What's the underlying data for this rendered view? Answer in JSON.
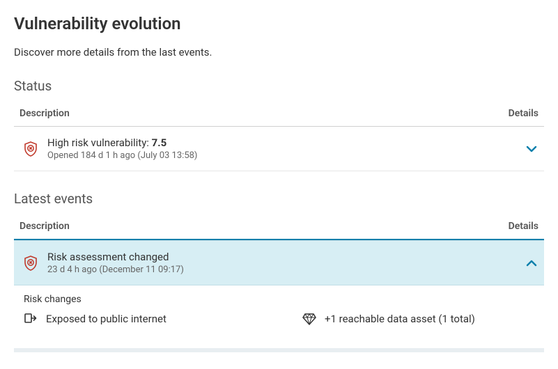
{
  "page": {
    "title": "Vulnerability evolution",
    "subtitle": "Discover more details from the last events."
  },
  "status": {
    "section_title": "Status",
    "columns": {
      "description": "Description",
      "details": "Details"
    },
    "row": {
      "title_prefix": "High risk vulnerability: ",
      "score": "7.5",
      "meta": "Opened 184 d 1 h ago (July 03 13:58)"
    }
  },
  "events": {
    "section_title": "Latest events",
    "columns": {
      "description": "Description",
      "details": "Details"
    },
    "row": {
      "title": "Risk assessment changed",
      "meta": "23 d 4 h ago (December 11 09:17)"
    },
    "risk_changes": {
      "title": "Risk changes",
      "items": [
        {
          "icon": "exposed",
          "label": "Exposed to public internet"
        },
        {
          "icon": "diamond",
          "label": "+1 reachable data asset (1 total)"
        }
      ]
    }
  }
}
